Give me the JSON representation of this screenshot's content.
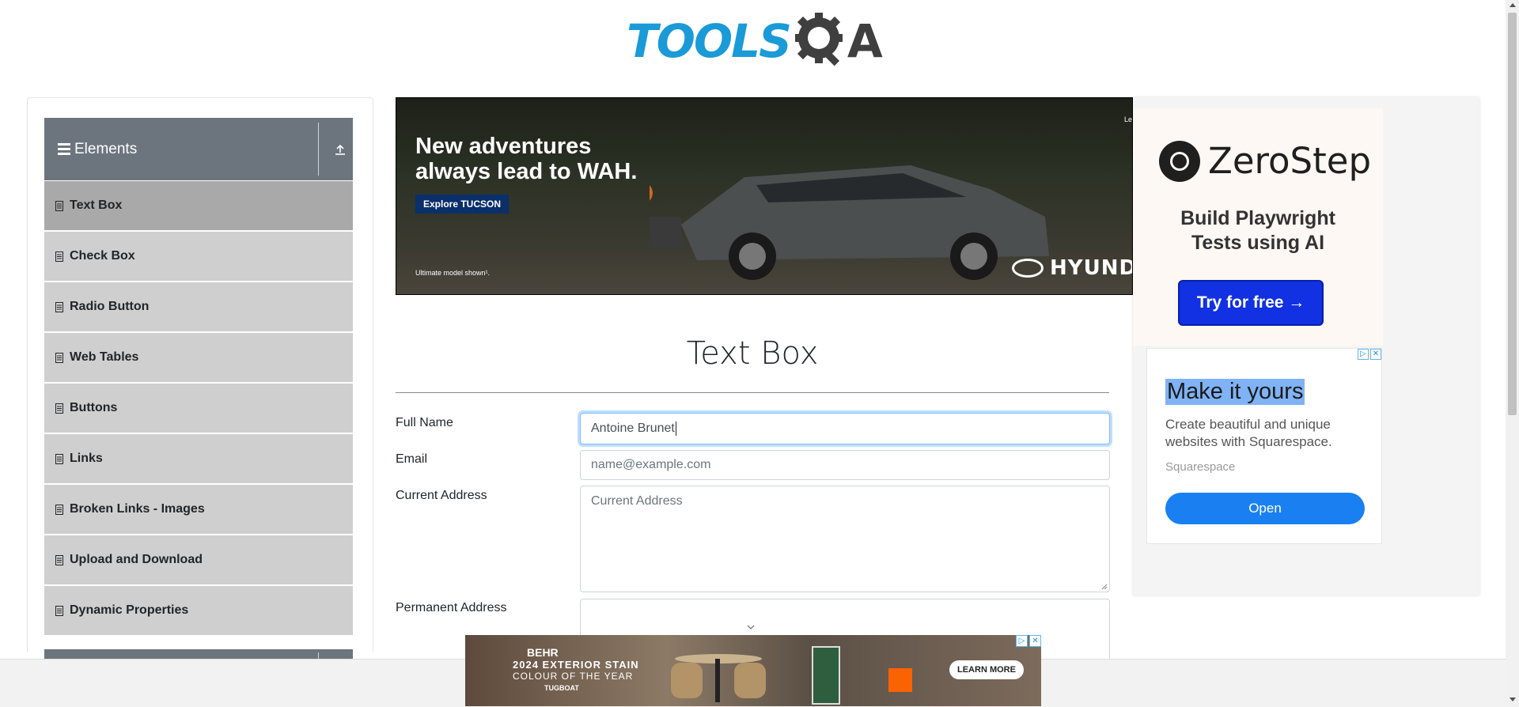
{
  "header": {
    "logo_text_tools": "TOOLS",
    "logo_text_a": "A",
    "logo_color_tools": "#1b9ad8",
    "logo_color_qa": "#3f3f3f"
  },
  "sidebar": {
    "group_title": "Elements",
    "group_icon": "hamburger-icon",
    "toggle_icon": "collapse-up-icon",
    "items": [
      {
        "label": "Text Box",
        "active": true
      },
      {
        "label": "Check Box",
        "active": false
      },
      {
        "label": "Radio Button",
        "active": false
      },
      {
        "label": "Web Tables",
        "active": false
      },
      {
        "label": "Buttons",
        "active": false
      },
      {
        "label": "Links",
        "active": false
      },
      {
        "label": "Broken Links - Images",
        "active": false
      },
      {
        "label": "Upload and Download",
        "active": false
      },
      {
        "label": "Dynamic Properties",
        "active": false
      }
    ]
  },
  "top_ad": {
    "headline_1": "New adventures",
    "headline_2": "always lead to WAH.",
    "cta": "Explore TUCSON",
    "footnote": "Ultimate model shown¹.",
    "brand": "HYUNDA",
    "corner_text": "Le"
  },
  "main": {
    "title": "Text Box",
    "form": {
      "full_name_label": "Full Name",
      "full_name_value": "Antoine Brunet",
      "email_label": "Email",
      "email_placeholder": "name@example.com",
      "current_address_label": "Current Address",
      "current_address_placeholder": "Current Address",
      "permanent_address_label": "Permanent Address"
    }
  },
  "right_ad_zerostep": {
    "brand": "ZeroStep",
    "tagline_1": "Build Playwright",
    "tagline_2": "Tests using AI",
    "button": "Try for free →"
  },
  "right_ad_squarespace": {
    "title": "Make it yours",
    "description": "Create beautiful and unique websites with Squarespace.",
    "source": "Squarespace",
    "button": "Open"
  },
  "bottom_ad": {
    "brand": "BEHR",
    "line1": "2024 EXTERIOR STAIN",
    "line2": "COLOUR OF THE YEAR",
    "line3": "TUGBOAT",
    "button": "LEARN MORE"
  }
}
